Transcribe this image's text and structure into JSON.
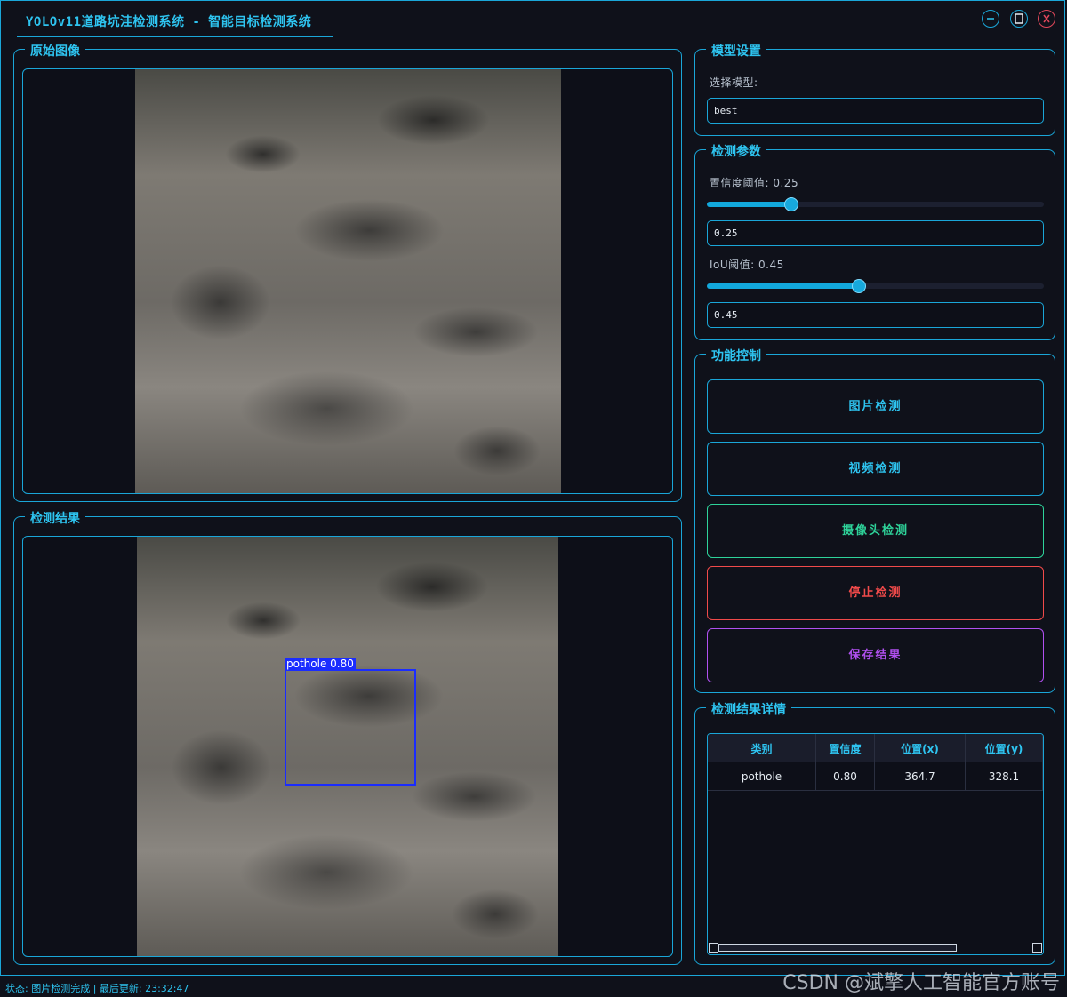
{
  "window": {
    "title": "YOLOv11道路坑洼检测系统 - 智能目标检测系统"
  },
  "panels": {
    "original": {
      "title": "原始图像"
    },
    "result": {
      "title": "检测结果"
    }
  },
  "detection_overlay": {
    "label": "pothole 0.80",
    "color": "#1a2cff"
  },
  "model": {
    "title": "模型设置",
    "select_label": "选择模型:",
    "selected": "best"
  },
  "params": {
    "title": "检测参数",
    "confidence": {
      "label": "置信度阈值: 0.25",
      "value": 0.25,
      "value_text": "0.25"
    },
    "iou": {
      "label": "IoU阈值: 0.45",
      "value": 0.45,
      "value_text": "0.45"
    }
  },
  "controls": {
    "title": "功能控制",
    "buttons": [
      {
        "label": "图片检测",
        "color": "#2ec4f0"
      },
      {
        "label": "视频检测",
        "color": "#2ec4f0"
      },
      {
        "label": "摄像头检测",
        "color": "#2ed39a"
      },
      {
        "label": "停止检测",
        "color": "#f04a4a"
      },
      {
        "label": "保存结果",
        "color": "#b050f0"
      }
    ]
  },
  "details": {
    "title": "检测结果详情",
    "columns": [
      "类别",
      "置信度",
      "位置(x)",
      "位置(y)"
    ],
    "rows": [
      [
        "pothole",
        "0.80",
        "364.7",
        "328.1"
      ]
    ]
  },
  "status": "状态: 图片检测完成 | 最后更新: 23:32:47",
  "watermark": "CSDN @斌擎人工智能官方账号",
  "colors": {
    "accent": "#1aa6d8",
    "background": "#0f111a"
  }
}
